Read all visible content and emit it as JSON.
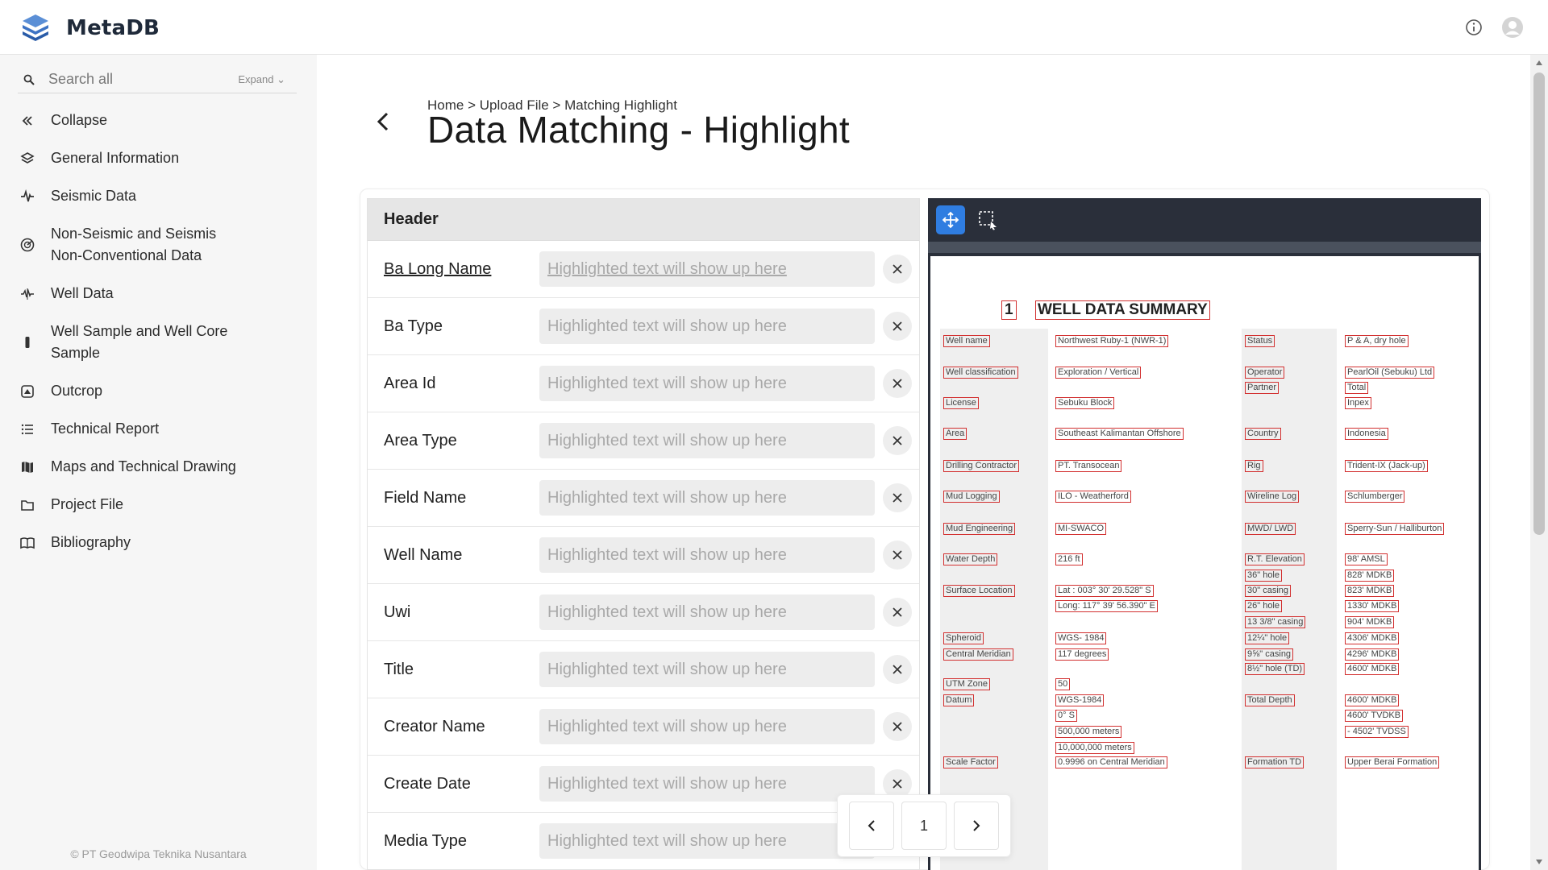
{
  "app": {
    "brand": "MetaDB"
  },
  "topbar": {
    "info_icon": "info-icon",
    "avatar_icon": "user-avatar-icon"
  },
  "sidebar": {
    "search": {
      "placeholder": "Search all",
      "expand_label": "Expand"
    },
    "items": [
      {
        "label": "Collapse",
        "icon": "double-chevron-left-icon"
      },
      {
        "label": "General Information",
        "icon": "layers-icon"
      },
      {
        "label": "Seismic Data",
        "icon": "waveform-icon"
      },
      {
        "label": "Non-Seismic and Seismis Non-Conventional Data",
        "icon": "radar-icon"
      },
      {
        "label": "Well Data",
        "icon": "well-pulse-icon"
      },
      {
        "label": "Well Sample and Well Core Sample",
        "icon": "core-sample-icon"
      },
      {
        "label": "Outcrop",
        "icon": "outcrop-icon"
      },
      {
        "label": "Technical Report",
        "icon": "list-icon"
      },
      {
        "label": "Maps and Technical Drawing",
        "icon": "map-icon"
      },
      {
        "label": "Project File",
        "icon": "folder-icon"
      },
      {
        "label": "Bibliography",
        "icon": "book-icon"
      }
    ],
    "copyright": "© PT Geodwipa Teknika Nusantara"
  },
  "main": {
    "breadcrumb": "Home > Upload File > Matching Highlight",
    "title": "Data Matching - Highlight"
  },
  "form": {
    "header": "Header",
    "placeholder": "Highlighted text will show up here",
    "fields": [
      {
        "label": "Ba Long Name"
      },
      {
        "label": "Ba Type"
      },
      {
        "label": "Area Id"
      },
      {
        "label": "Area Type"
      },
      {
        "label": "Field Name"
      },
      {
        "label": "Well Name"
      },
      {
        "label": "Uwi"
      },
      {
        "label": "Title"
      },
      {
        "label": "Creator Name"
      },
      {
        "label": "Create Date"
      },
      {
        "label": "Media Type"
      }
    ]
  },
  "viewer": {
    "tools": [
      "move-icon",
      "select-area-icon"
    ],
    "doc": {
      "number": "1",
      "title": "WELL DATA SUMMARY",
      "col1": [
        "Well name",
        "Well classification",
        "License",
        "Area",
        "Drilling Contractor",
        "Mud Logging",
        "Mud Engineering",
        "Water Depth",
        "Surface Location",
        "Spheroid",
        "Central Meridian",
        "UTM Zone",
        "Datum",
        "Scale Factor"
      ],
      "col2": [
        "Northwest Ruby-1 (NWR-1)",
        "Exploration / Vertical",
        "Sebuku Block",
        "Southeast Kalimantan Offshore",
        "PT. Transocean",
        "ILO - Weatherford",
        "MI-SWACO",
        "216 ft",
        "Lat : 003° 30' 29.528\" S",
        "Long: 117° 39' 56.390\" E",
        "WGS- 1984",
        "117 degrees",
        "50",
        "WGS-1984",
        "0° S",
        "500,000 meters",
        "10,000,000 meters",
        "0.9996 on Central Meridian"
      ],
      "col3": [
        "Status",
        "Operator",
        "Partner",
        "Country",
        "Rig",
        "Wireline Log",
        "MWD/ LWD",
        "R.T. Elevation",
        "36\" hole",
        "30\" casing",
        "26\" hole",
        "13 3/8\" casing",
        "12¼\" hole",
        "9⅝\" casing",
        "8½\" hole (TD)",
        "Total Depth",
        "Formation TD"
      ],
      "col4": [
        "P & A, dry hole",
        "PearlOil (Sebuku) Ltd",
        "Total",
        "Inpex",
        "Indonesia",
        "Trident-IX (Jack-up)",
        "Schlumberger",
        "Sperry-Sun / Halliburton",
        "98' AMSL",
        "828' MDKB",
        "823' MDKB",
        "1330' MDKB",
        "904' MDKB",
        "4306' MDKB",
        "4296' MDKB",
        "4600' MDKB",
        "4600' MDKB",
        "4600' TVDKB",
        "- 4502' TVDSS",
        "Upper Berai Formation"
      ]
    }
  },
  "pager": {
    "current": "1"
  }
}
